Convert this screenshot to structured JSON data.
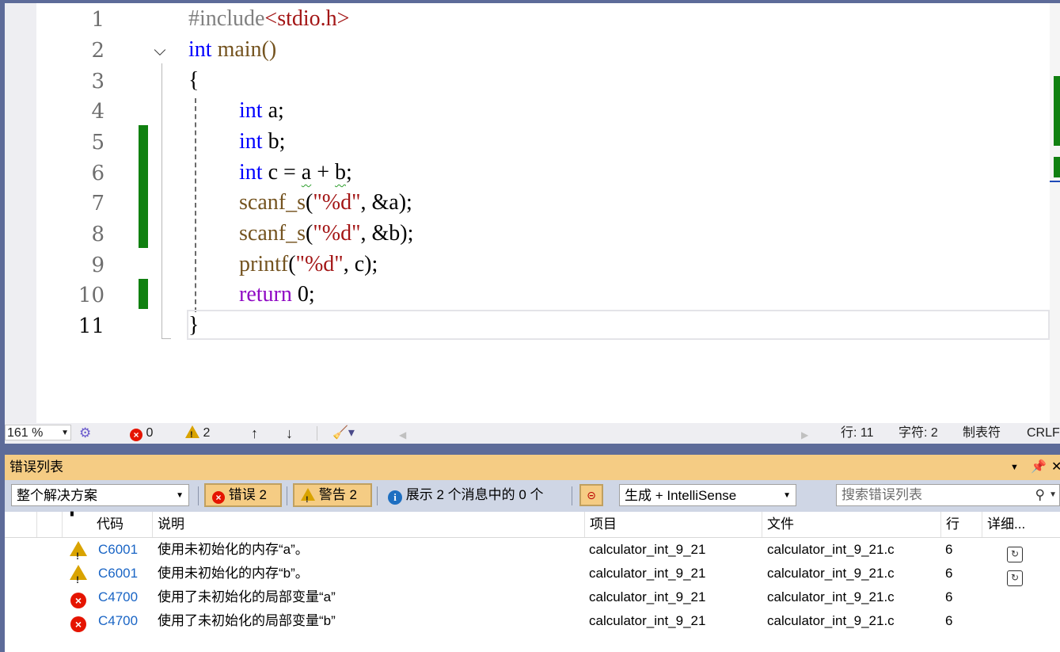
{
  "editor": {
    "lines": [
      "1",
      "2",
      "3",
      "4",
      "5",
      "6",
      "7",
      "8",
      "9",
      "10",
      "11"
    ],
    "code": {
      "l1_directive": "#include",
      "l1_header": "<stdio.h>",
      "l2_kw": "int",
      "l2_rest": " main()",
      "l3": "{",
      "l4_kw": "int",
      "l4_var": "a",
      "l4_end": ";",
      "l5_kw": "int",
      "l5_var": "b",
      "l5_end": ";",
      "l6_kw": "int",
      "l6_mid": " c = ",
      "l6_a": "a",
      "l6_plus": " + ",
      "l6_b": "b",
      "l6_end": ";",
      "l7_fn": "scanf_s",
      "l7_open": "(",
      "l7_str": "\"%d\"",
      "l7_rest": ", &a);",
      "l8_fn": "scanf_s",
      "l8_open": "(",
      "l8_str": "\"%d\"",
      "l8_rest": ", &b);",
      "l9_fn": "printf",
      "l9_open": "(",
      "l9_str": "\"%d\"",
      "l9_rest": ", c);",
      "l10_kw": "return",
      "l10_rest": " 0;",
      "l11": "}"
    }
  },
  "status_bar": {
    "zoom": "161 %",
    "errors": "0",
    "warnings": "2",
    "up_arrow": "↑",
    "down_arrow": "↓",
    "line": "行: 11",
    "char": "字符: 2",
    "tabs": "制表符",
    "eol": "CRLF"
  },
  "error_list": {
    "title": "错误列表",
    "scope": "整个解决方案",
    "errors_btn": "错误 2",
    "warnings_btn": "警告 2",
    "messages_text": "展示 2 个消息中的 0 个",
    "build_filter": "生成 + IntelliSense",
    "search_placeholder": "搜索错误列表",
    "columns": {
      "code": "代码",
      "description": "说明",
      "project": "项目",
      "file": "文件",
      "line": "行",
      "details": "详细..."
    },
    "rows": [
      {
        "severity": "warning",
        "code": "C6001",
        "description": "使用未初始化的内存“a”。",
        "project": "calculator_int_9_21",
        "file": "calculator_int_9_21.c",
        "line": "6"
      },
      {
        "severity": "warning",
        "code": "C6001",
        "description": "使用未初始化的内存“b”。",
        "project": "calculator_int_9_21",
        "file": "calculator_int_9_21.c",
        "line": "6"
      },
      {
        "severity": "error",
        "code": "C4700",
        "description": "使用了未初始化的局部变量“a”",
        "project": "calculator_int_9_21",
        "file": "calculator_int_9_21.c",
        "line": "6"
      },
      {
        "severity": "error",
        "code": "C4700",
        "description": "使用了未初始化的局部变量“b”",
        "project": "calculator_int_9_21",
        "file": "calculator_int_9_21.c",
        "line": "6"
      }
    ]
  },
  "colors": {
    "keyword": "#0000ff",
    "string": "#a31515",
    "function": "#74531f",
    "return_kw": "#8f08c4",
    "change_bar": "#108010",
    "panel_title_bg": "#f5cc84",
    "error_red": "#e51400",
    "warning_yellow": "#d9a300"
  }
}
